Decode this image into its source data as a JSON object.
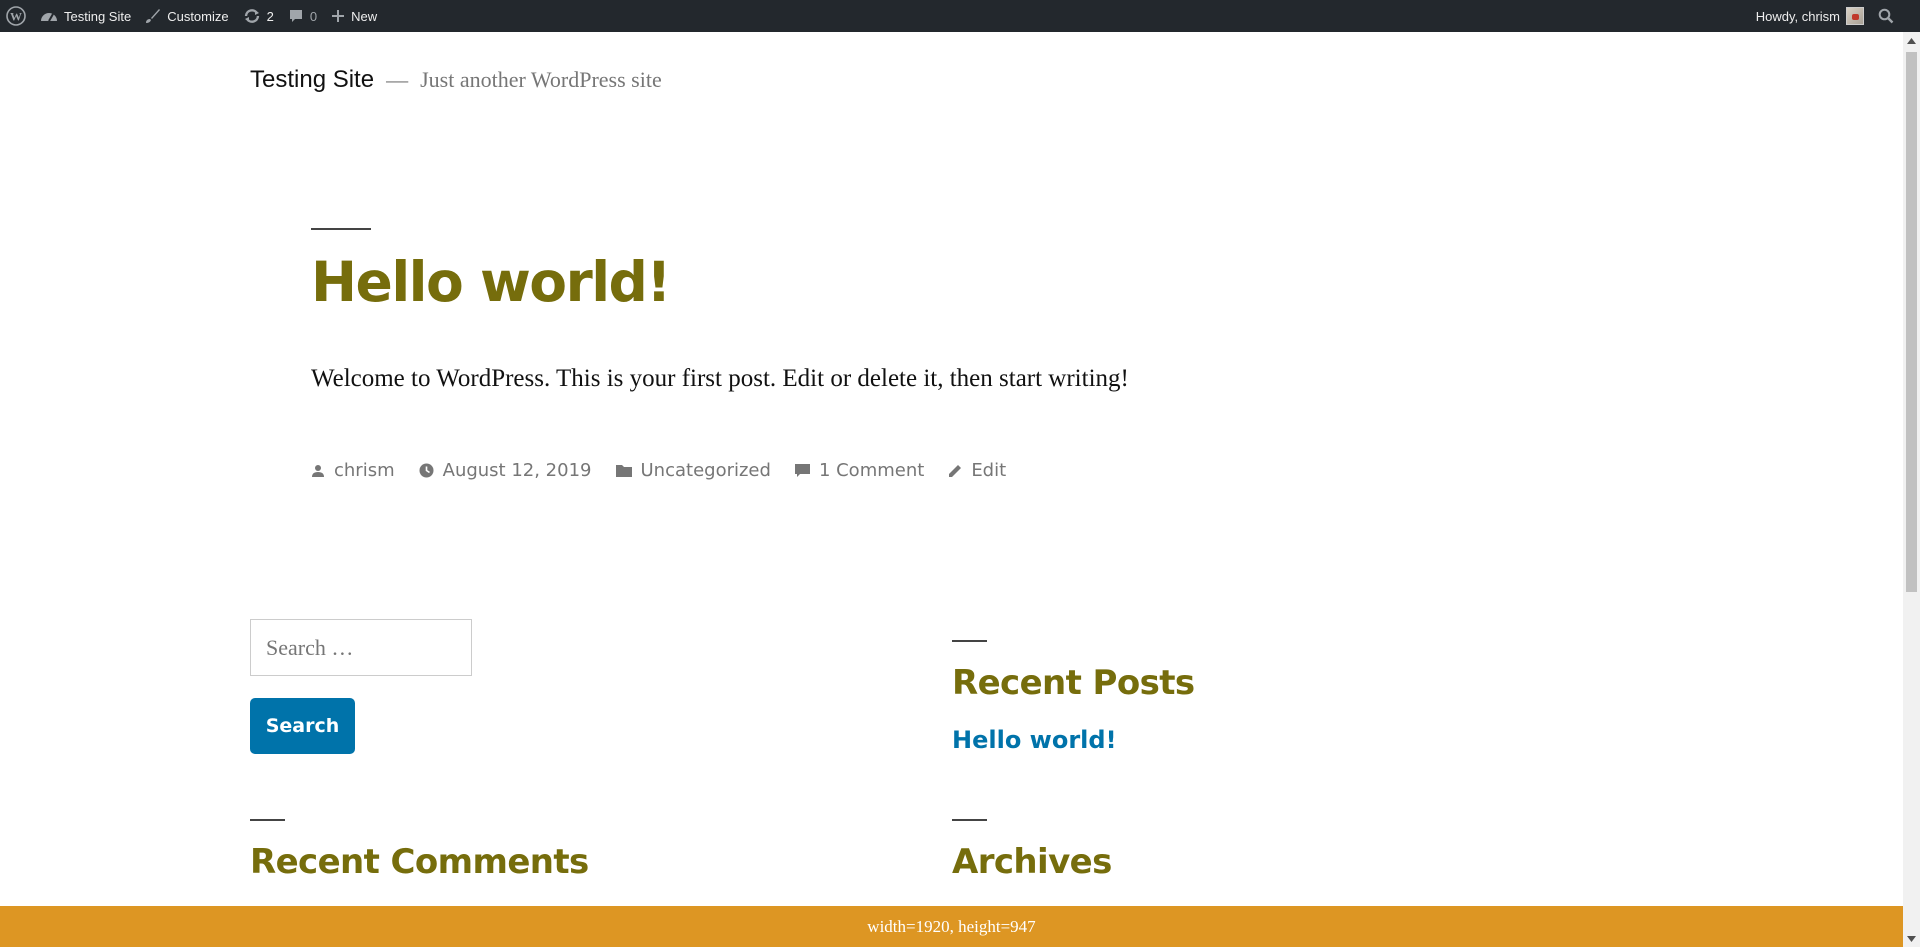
{
  "admin_bar": {
    "site_name": "Testing Site",
    "customize": "Customize",
    "updates_count": "2",
    "comments_count": "0",
    "new_label": "New",
    "howdy": "Howdy, chrism"
  },
  "header": {
    "site_title": "Testing Site",
    "separator": "—",
    "description": "Just another WordPress site"
  },
  "post": {
    "title": "Hello world!",
    "content": "Welcome to WordPress. This is your first post. Edit or delete it, then start writing!",
    "author": "chrism",
    "date": "August 12, 2019",
    "category": "Uncategorized",
    "comments": "1 Comment",
    "edit": "Edit"
  },
  "widgets": {
    "search_placeholder": "Search …",
    "search_button": "Search",
    "recent_posts_title": "Recent Posts",
    "recent_posts": [
      "Hello world!"
    ],
    "recent_comments_title": "Recent Comments",
    "archives_title": "Archives"
  },
  "overlay": {
    "size_text": "width=1920, height=947"
  },
  "colors": {
    "admin_bar_bg": "#23282d",
    "heading": "#766d0c",
    "link": "#0073aa",
    "button": "#0073aa",
    "overlay_bar": "#dd9623"
  }
}
